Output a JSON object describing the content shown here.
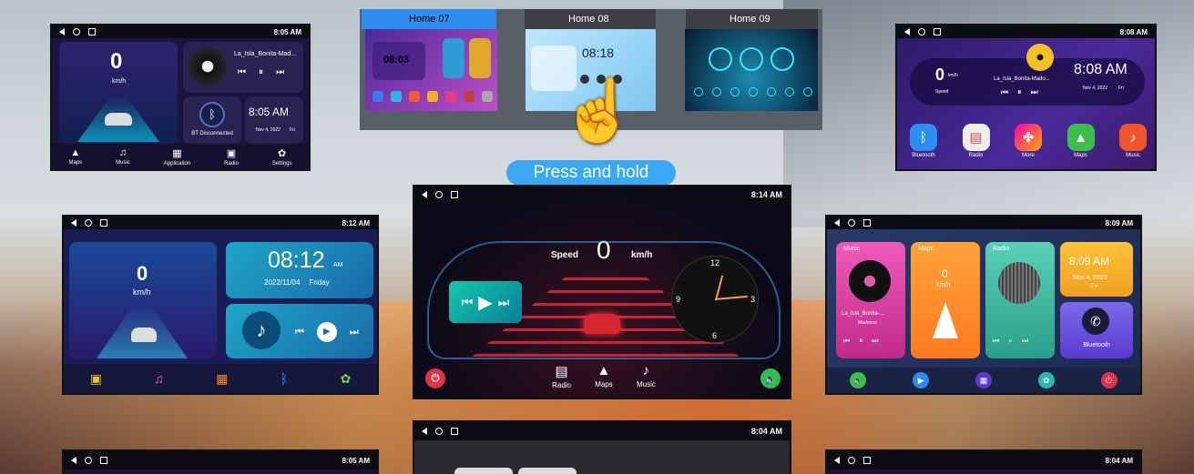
{
  "overlay": {
    "press_hold": "Press and hold",
    "hand": "☝"
  },
  "homes": [
    "Home 07",
    "Home 08",
    "Home 09"
  ],
  "h07": {
    "time": "08:03"
  },
  "h08": {
    "time": "08:18"
  },
  "s1": {
    "status_time": "8:05 AM",
    "speed": "0",
    "unit": "km/h",
    "song": "La_Isla_Bonita-Mad...",
    "bt": "BT Disconnected",
    "clock": "8:05 AM",
    "date": "Nov 4, 2022",
    "day": "Fri",
    "dock": [
      "Maps",
      "Music",
      "Application",
      "Radio",
      "Settings"
    ]
  },
  "s2": {
    "status_time": "8:08 AM",
    "speed": "0",
    "unit": "km/h",
    "speed_label": "Speed",
    "song": "La_Isla_Bonita-Mado...",
    "clock": "8:08 AM",
    "date": "Nov 4, 2022",
    "day": "Fri",
    "apps": [
      "Bluetooth",
      "Radio",
      "More",
      "Maps",
      "Music"
    ]
  },
  "s3": {
    "status_time": "8:12 AM",
    "speed": "0",
    "unit": "km/h",
    "clock": "08:12",
    "ampm": "AM",
    "date": "2022/11/04",
    "day": "Friday"
  },
  "s4": {
    "status_time": "8:14 AM",
    "speed_label": "Speed",
    "speed": "0",
    "unit": "km/h",
    "dock": [
      "Radio",
      "Maps",
      "Music"
    ],
    "clock_nums": [
      "12",
      "3",
      "6",
      "9"
    ]
  },
  "s5": {
    "status_time": "8:09 AM",
    "music": "Music",
    "maps": "Maps",
    "radio": "Radio",
    "speed": "0",
    "unit": "km/h",
    "song": "La_Isla_Bonita-...",
    "artist": "Madonna",
    "clock": "8:09 AM",
    "date": "Nov 4, 2022",
    "day": "Fri",
    "bt": "Bluetooth"
  },
  "s6": {
    "status_time": "8:05 AM"
  },
  "s7": {
    "status_time": "8:04 AM"
  },
  "s8": {
    "status_time": "8:04 AM"
  },
  "colors": {
    "accent": "#2ea8ff",
    "orange": "#ff8a1e",
    "pink": "#e0338e"
  }
}
